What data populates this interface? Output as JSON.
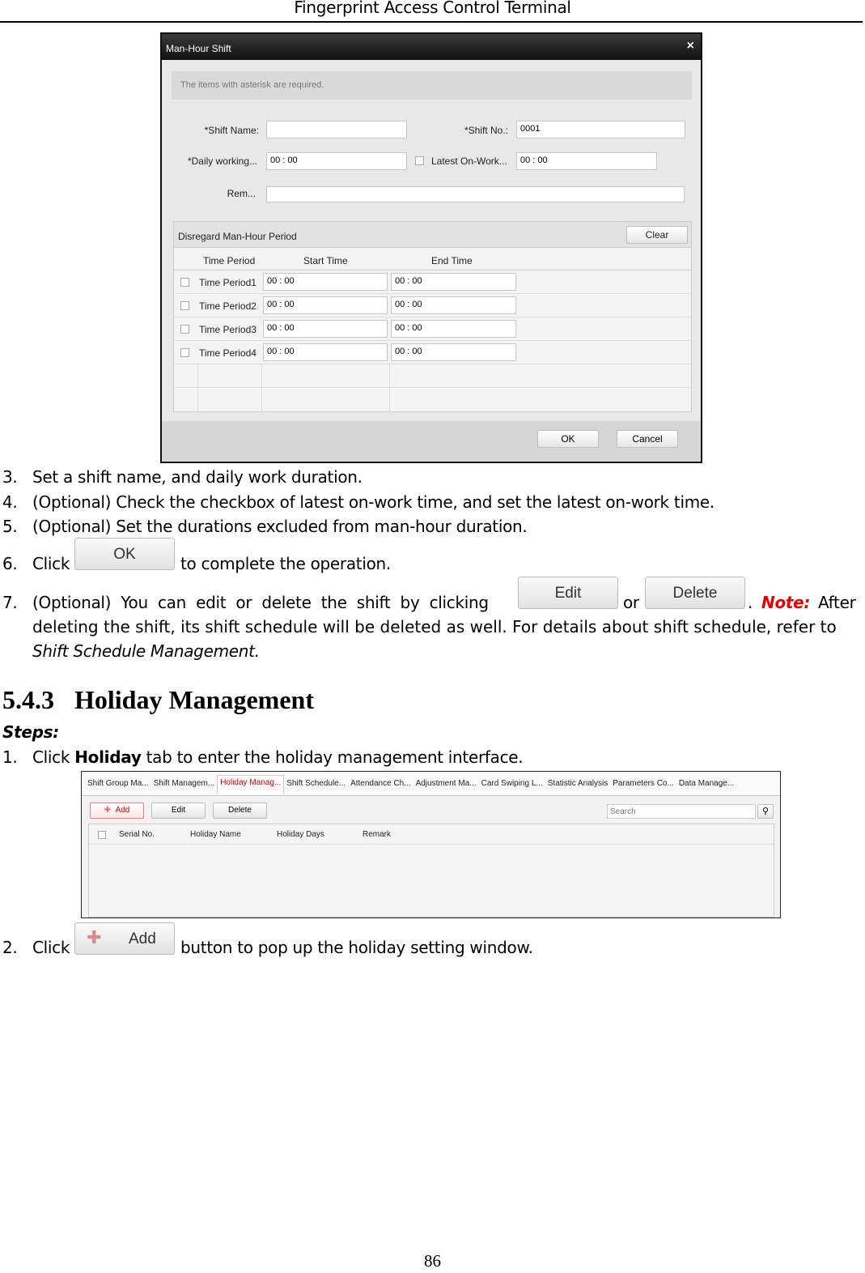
{
  "header": {
    "title": "Fingerprint Access Control Terminal"
  },
  "dialog": {
    "title": "Man-Hour Shift",
    "close": "×",
    "notice": "The items with asterisk are required.",
    "shift_name_label": "*Shift Name:",
    "shift_name_value": "",
    "shift_no_label": "*Shift No.:",
    "shift_no_value": "0001",
    "daily_label": "*Daily working...",
    "daily_value": "00 : 00",
    "latest_label": "Latest On-Work...",
    "latest_value": "00 : 00",
    "remark_label": "Rem...",
    "remark_value": "",
    "section_title": "Disregard Man-Hour Period",
    "clear": "Clear",
    "columns": [
      "Time Period",
      "Start Time",
      "End Time"
    ],
    "rows": [
      {
        "name": "Time Period1",
        "start": "00 : 00",
        "end": "00 : 00"
      },
      {
        "name": "Time Period2",
        "start": "00 : 00",
        "end": "00 : 00"
      },
      {
        "name": "Time Period3",
        "start": "00 : 00",
        "end": "00 : 00"
      },
      {
        "name": "Time Period4",
        "start": "00 : 00",
        "end": "00 : 00"
      }
    ],
    "ok": "OK",
    "cancel": "Cancel"
  },
  "steps_a": [
    {
      "num": "3.",
      "text": "Set a shift name, and daily work duration."
    },
    {
      "num": "4.",
      "text": "(Optional) Check the checkbox of latest on-work time, and set the latest on-work time."
    },
    {
      "num": "5.",
      "text": "(Optional) Set the durations excluded from man-hour duration."
    }
  ],
  "step6": {
    "num": "6.",
    "pre": "Click",
    "button": "OK",
    "post": "to complete the operation."
  },
  "step7": {
    "num": "7.",
    "pre": "(Optional)  You  can  edit  or  delete  the  shift  by  clicking",
    "edit": "Edit",
    "or": "or",
    "delete": "Delete",
    "dot": ".",
    "note": "Note:",
    "after": "After",
    "line2": "deleting the shift, its shift schedule will be deleted as well. For details about shift schedule, refer to",
    "line3": "Shift Schedule Management."
  },
  "section": {
    "number": "5.4.3",
    "title": "Holiday Management"
  },
  "steps_label": "Steps:",
  "step1": {
    "num": "1.",
    "pre": "Click",
    "bold": "Holiday",
    "post": "tab to enter the holiday management interface."
  },
  "holiday_ui": {
    "tabs": [
      "Shift Group Ma...",
      "Shift Managem...",
      "Holiday Manag...",
      "Shift Schedule...",
      "Attendance Ch...",
      "Adjustment Ma...",
      "Card Swiping L...",
      "Statistic Analysis",
      "Parameters Co...",
      "Data Manage..."
    ],
    "active_tab": 2,
    "add": "Add",
    "edit": "Edit",
    "delete": "Delete",
    "search_placeholder": "Search",
    "columns": [
      "Serial No.",
      "Holiday Name",
      "Holiday Days",
      "Remark"
    ]
  },
  "step2": {
    "num": "2.",
    "pre": "Click",
    "button": "Add",
    "post": "button to pop up the holiday setting window."
  },
  "page_number": "86",
  "colors": {
    "note": "#e00000",
    "active_tab": "#c00000",
    "dialog_title_bar": "#1e1e1e"
  }
}
